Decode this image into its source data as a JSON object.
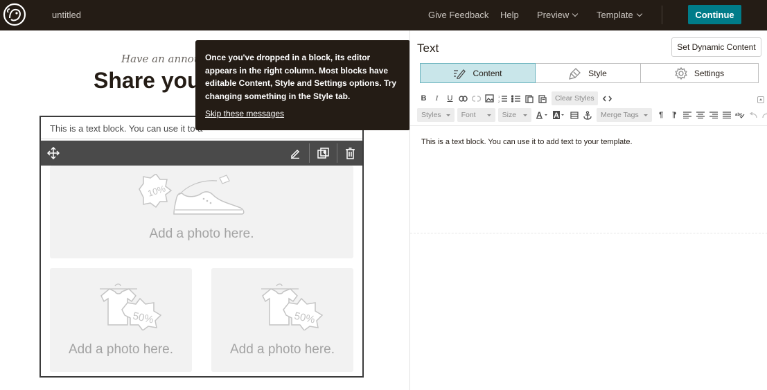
{
  "header": {
    "doc_title": "untitled",
    "nav": {
      "give_feedback": "Give Feedback",
      "help": "Help",
      "preview": "Preview",
      "template": "Template"
    },
    "continue_label": "Continue",
    "accent_color": "#007c89"
  },
  "canvas": {
    "announce": "Have an annou",
    "headline": "Share you",
    "text_block": "This is a text block. You can use it to a",
    "photo_label": "Add a photo here.",
    "photo_large_badge": "10%",
    "photo_small_badge": "50%"
  },
  "tooltip": {
    "text": "Once you've dropped in a block, its editor appears in the right column. Most blocks have editable Content, Style and Settings options. Try changing something in the Style tab.",
    "skip_link": "Skip these messages"
  },
  "editor": {
    "title": "Text",
    "dynamic_button": "Set Dynamic Content",
    "tabs": {
      "content": "Content",
      "style": "Style",
      "settings": "Settings"
    },
    "active_tab": "content",
    "toolbar": {
      "bold": "B",
      "italic": "I",
      "underline": "U",
      "clear_styles": "Clear Styles",
      "styles": "Styles",
      "font": "Font",
      "size": "Size",
      "merge_tags": "Merge Tags"
    },
    "body_text": "This is a text block. You can use it to add text to your template."
  }
}
